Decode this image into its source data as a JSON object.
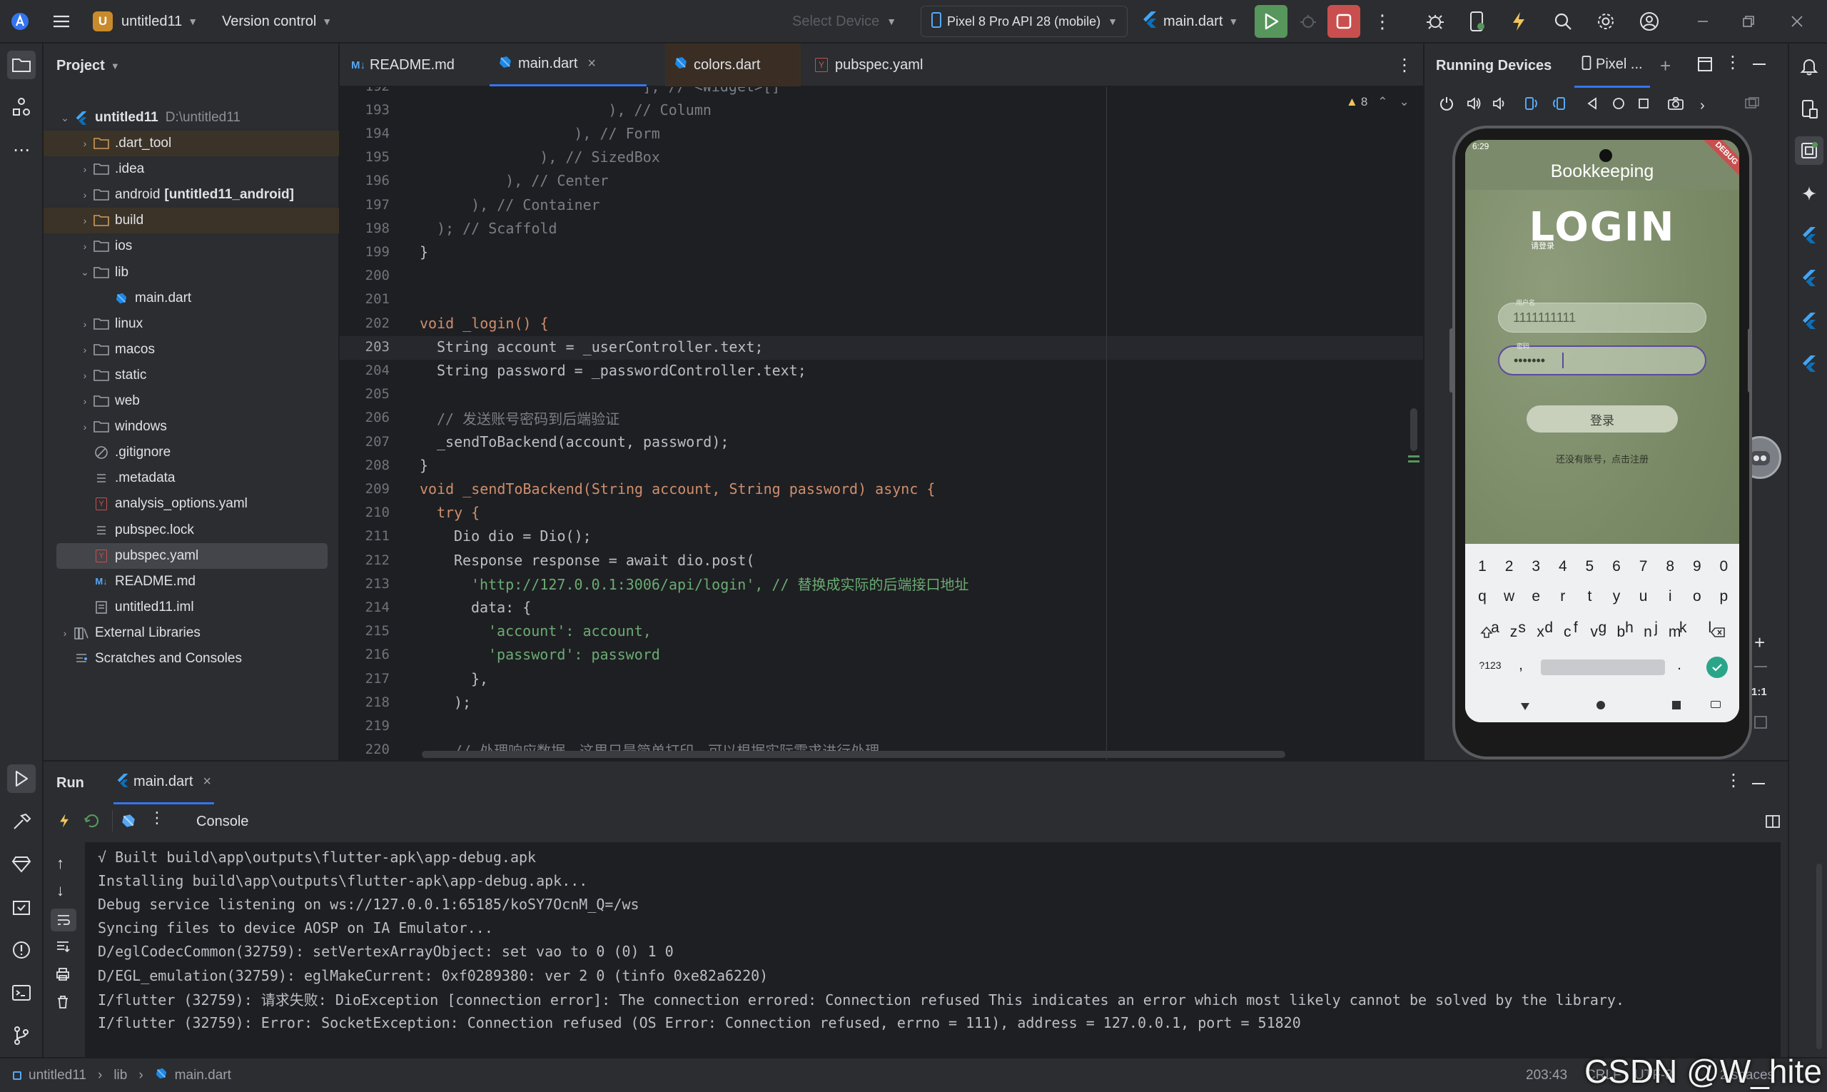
{
  "titlebar": {
    "project_badge": "U",
    "project_name": "untitled11",
    "vcs_label": "Version control",
    "select_device": "Select Device",
    "device": "Pixel 8 Pro API 28 (mobile)",
    "run_config": "main.dart"
  },
  "project_panel": {
    "title": "Project",
    "root_name": "untitled11",
    "root_path": "D:\\untitled11",
    "items": [
      {
        "label": ".dart_tool",
        "type": "folder-excluded"
      },
      {
        "label": ".idea",
        "type": "folder"
      },
      {
        "label": "android",
        "extra": "[untitled11_android]",
        "type": "folder"
      },
      {
        "label": "build",
        "type": "folder-excluded"
      },
      {
        "label": "ios",
        "type": "folder"
      },
      {
        "label": "lib",
        "type": "folder"
      },
      {
        "label": "main.dart",
        "type": "dart"
      },
      {
        "label": "linux",
        "type": "folder"
      },
      {
        "label": "macos",
        "type": "folder"
      },
      {
        "label": "static",
        "type": "folder"
      },
      {
        "label": "web",
        "type": "folder"
      },
      {
        "label": "windows",
        "type": "folder"
      },
      {
        "label": ".gitignore",
        "type": "ignore"
      },
      {
        "label": ".metadata",
        "type": "text"
      },
      {
        "label": "analysis_options.yaml",
        "type": "yaml"
      },
      {
        "label": "pubspec.lock",
        "type": "text"
      },
      {
        "label": "pubspec.yaml",
        "type": "yaml"
      },
      {
        "label": "README.md",
        "type": "md"
      },
      {
        "label": "untitled11.iml",
        "type": "iml"
      },
      {
        "label": "External Libraries",
        "type": "lib"
      },
      {
        "label": "Scratches and Consoles",
        "type": "scratch"
      }
    ]
  },
  "editor_tabs": [
    {
      "label": "README.md",
      "icon": "markdown-icon"
    },
    {
      "label": "main.dart",
      "icon": "dart-icon",
      "active": true
    },
    {
      "label": "colors.dart",
      "icon": "dart-icon"
    },
    {
      "label": "pubspec.yaml",
      "icon": "yaml-icon"
    }
  ],
  "editor": {
    "warnings_count": "8",
    "lines": [
      {
        "n": "192",
        "text": "            ], // <Widget>[]"
      },
      {
        "n": "193",
        "text": "          ), // Column"
      },
      {
        "n": "194",
        "text": "        ), // Form"
      },
      {
        "n": "195",
        "text": "      ), // SizedBox"
      },
      {
        "n": "196",
        "text": "    ), // Center"
      },
      {
        "n": "197",
        "text": "  ), // Container"
      },
      {
        "n": "198",
        "text": "); // Scaffold"
      },
      {
        "n": "199",
        "text": "}"
      },
      {
        "n": "200",
        "text": ""
      },
      {
        "n": "201",
        "text": ""
      },
      {
        "n": "202",
        "text": "void _login() {"
      },
      {
        "n": "203",
        "text": "String account = _userController.text;"
      },
      {
        "n": "204",
        "text": "String password = _passwordController.text;"
      },
      {
        "n": "205",
        "text": ""
      },
      {
        "n": "206",
        "text": "// 发送账号密码到后端验证"
      },
      {
        "n": "207",
        "text": "_sendToBackend(account, password);"
      },
      {
        "n": "208",
        "text": "}"
      },
      {
        "n": "209",
        "text": "void _sendToBackend(String account, String password) async {"
      },
      {
        "n": "210",
        "text": "try {"
      },
      {
        "n": "211",
        "text": "Dio dio = Dio();"
      },
      {
        "n": "212",
        "text": "Response response = await dio.post("
      },
      {
        "n": "213",
        "text": "'http://127.0.0.1:3006/api/login', // 替换成实际的后端接口地址"
      },
      {
        "n": "214",
        "text": "data: {"
      },
      {
        "n": "215",
        "text": "'account': account,"
      },
      {
        "n": "216",
        "text": "'password': password"
      },
      {
        "n": "217",
        "text": "},"
      },
      {
        "n": "218",
        "text": ");"
      },
      {
        "n": "219",
        "text": ""
      },
      {
        "n": "220",
        "text": "// 处理响应数据，这里只是简单打印，可以根据实际需求进行处理"
      }
    ]
  },
  "devices": {
    "title": "Running Devices",
    "tab_label": "Pixel ...",
    "zoom_label": "1:1"
  },
  "phone": {
    "status_time": "6:29",
    "app_title": "Bookkeeping",
    "login_title": "LOGIN",
    "login_subtitle": "请登录",
    "username_label": "用户名",
    "username_value": "1111111111",
    "password_label": "密码",
    "password_value": "•••••••",
    "login_button": "登录",
    "register_link": "还没有账号，点击注册",
    "debug_banner": "DEBUG",
    "keyboard": {
      "row1": [
        "1",
        "2",
        "3",
        "4",
        "5",
        "6",
        "7",
        "8",
        "9",
        "0"
      ],
      "row2": [
        "q",
        "w",
        "e",
        "r",
        "t",
        "y",
        "u",
        "i",
        "o",
        "p"
      ],
      "row3": [
        "a",
        "s",
        "d",
        "f",
        "g",
        "h",
        "j",
        "k",
        "l"
      ],
      "row4": [
        "z",
        "x",
        "c",
        "v",
        "b",
        "n",
        "m"
      ],
      "sym": "?123",
      "comma": ",",
      "period": "."
    }
  },
  "run_panel": {
    "title": "Run",
    "tab_label": "main.dart",
    "console_label": "Console",
    "lines": [
      "√ Built build\\app\\outputs\\flutter-apk\\app-debug.apk",
      "Installing build\\app\\outputs\\flutter-apk\\app-debug.apk...",
      "Debug service listening on ws://127.0.0.1:65185/koSY7OcnM_Q=/ws",
      "Syncing files to device AOSP on IA Emulator...",
      "D/eglCodecCommon(32759): setVertexArrayObject: set vao to 0 (0) 1 0",
      "D/EGL_emulation(32759): eglMakeCurrent: 0xf0289380: ver 2 0 (tinfo 0xe82a6220)",
      "I/flutter (32759): 请求失败: DioException [connection error]: The connection errored: Connection refused This indicates an error which most likely cannot be solved by the library.",
      "I/flutter (32759): Error: SocketException: Connection refused (OS Error: Connection refused, errno = 111), address = 127.0.0.1, port = 51820"
    ]
  },
  "statusbar": {
    "crumbs": [
      "untitled11",
      "lib",
      "main.dart"
    ],
    "position": "203:43",
    "line_sep": "CRLF",
    "encoding": "UTF-8",
    "indent": "2 spaces",
    "watermark": "CSDN @W_hite"
  },
  "colors": {
    "bg": "#1e1f22",
    "panel": "#2b2d30",
    "accent": "#3574f0",
    "run_green": "#57965c",
    "stop_red": "#c94f4f"
  }
}
